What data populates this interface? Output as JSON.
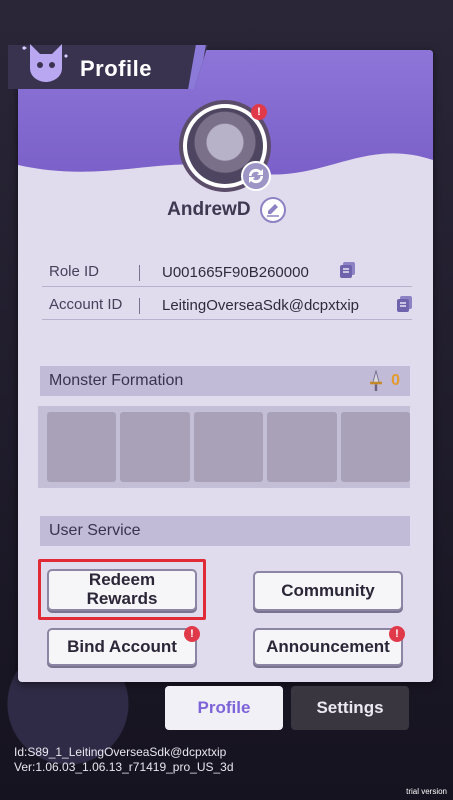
{
  "window": {
    "title": "Profile"
  },
  "profile": {
    "username": "AndrewD",
    "role_id_label": "Role ID",
    "role_id_value": "U001665F90B260000",
    "account_id_label": "Account ID",
    "account_id_value": "LeitingOverseaSdk@dcpxtxip"
  },
  "formation": {
    "title": "Monster Formation",
    "count": "0",
    "slot_count": 5
  },
  "service": {
    "title": "User Service",
    "redeem_label": "Redeem\nRewards",
    "community_label": "Community",
    "bind_label": "Bind Account",
    "announcement_label": "Announcement",
    "badge_mark": "!"
  },
  "tabs": {
    "profile": "Profile",
    "settings": "Settings"
  },
  "footer": {
    "id_line": "Id:S89_1_LeitingOverseaSdk@dcpxtxip",
    "ver_line": "Ver:1.06.03_1.06.13_r71419_pro_US_3d",
    "trial": "trial version"
  },
  "colors": {
    "accent": "#7d63d8",
    "highlight": "#e02b36",
    "badge": "#e03a4a",
    "count": "#e39a2e"
  },
  "icons": [
    "cat-icon",
    "edit-icon",
    "copy-icon",
    "swap-icon",
    "sword-icon",
    "alert-badge-icon"
  ]
}
